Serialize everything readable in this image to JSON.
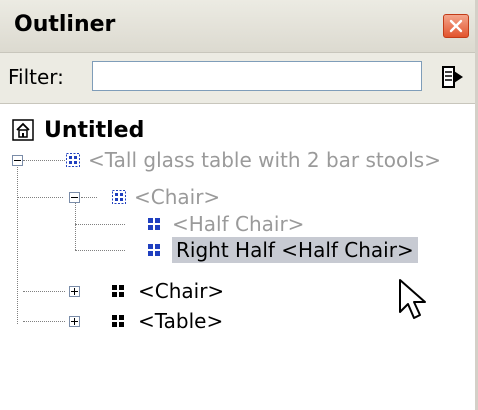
{
  "panel": {
    "title": "Outliner"
  },
  "filter": {
    "label": "Filter:",
    "value": "",
    "placeholder": ""
  },
  "tree": {
    "root": "Untitled",
    "nodes": [
      "<Tall glass table with 2 bar stools>",
      "<Chair>",
      "<Half Chair>",
      "Right Half <Half Chair>",
      "<Chair>",
      "<Table>"
    ]
  },
  "colors": {
    "selection": "#c7cad2",
    "hidden_text": "#9a9a9a",
    "component_icon": "#1f3fbf"
  }
}
